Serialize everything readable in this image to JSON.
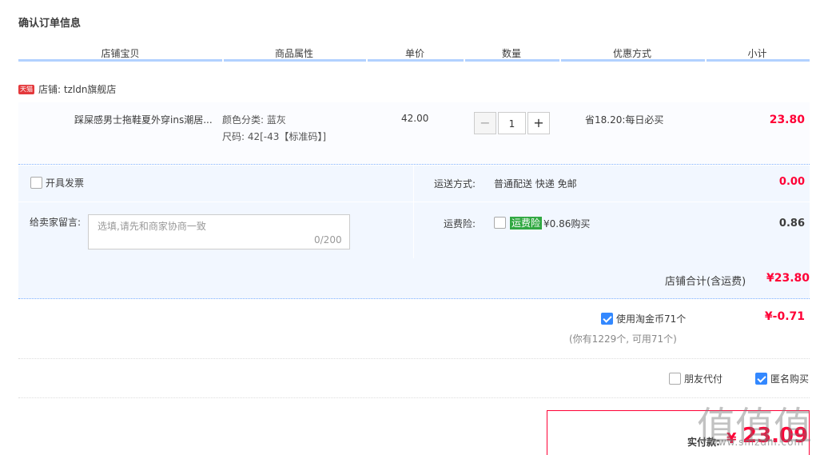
{
  "page_title": "确认订单信息",
  "columns": [
    "店铺宝贝",
    "商品属性",
    "单价",
    "数量",
    "优惠方式",
    "小计"
  ],
  "shop": {
    "badge": "天猫",
    "label": "店铺: tzldn旗舰店"
  },
  "item": {
    "name": "踩屎感男士拖鞋夏外穿ins潮居...",
    "attr_color": "颜色分类: 蓝灰",
    "attr_size": "尺码: 42[-43【标准码】]",
    "price": "42.00",
    "quantity": "1",
    "promo": "省18.20:每日必买",
    "subtotal": "23.80"
  },
  "invoice": {
    "label": "开具发票",
    "checked": false
  },
  "message": {
    "label": "给卖家留言:",
    "placeholder": "选填,请先和商家协商一致",
    "count": "0/200"
  },
  "shipping": {
    "label": "运送方式:",
    "value": "普通配送 快递 免邮",
    "cost": "0.00"
  },
  "insurance": {
    "label": "运费险:",
    "tag": "运费险",
    "price": "¥0.86购买",
    "cost": "0.86",
    "checked": false
  },
  "shop_total": {
    "label": "店铺合计(含运费)",
    "value": "¥23.80"
  },
  "coins": {
    "label": "使用淘金币71个",
    "checked": true,
    "discount": "¥-0.71",
    "note": "(你有1229个, 可用71个)"
  },
  "options": {
    "friend_pay": {
      "label": "朋友代付",
      "checked": false
    },
    "anonymous": {
      "label": "匿名购买",
      "checked": true
    }
  },
  "payment": {
    "label": "实付款:",
    "symbol": "¥",
    "value": "23.09"
  },
  "watermark": {
    "logo": "值值值",
    "site": "www.smzdm.com"
  },
  "colors": {
    "accent_red": "#ff0036",
    "panel_blue": "#f2f7ff",
    "header_line": "#b2d1ff",
    "checkbox_blue": "#3388ff",
    "insurance_green": "#31a842"
  }
}
